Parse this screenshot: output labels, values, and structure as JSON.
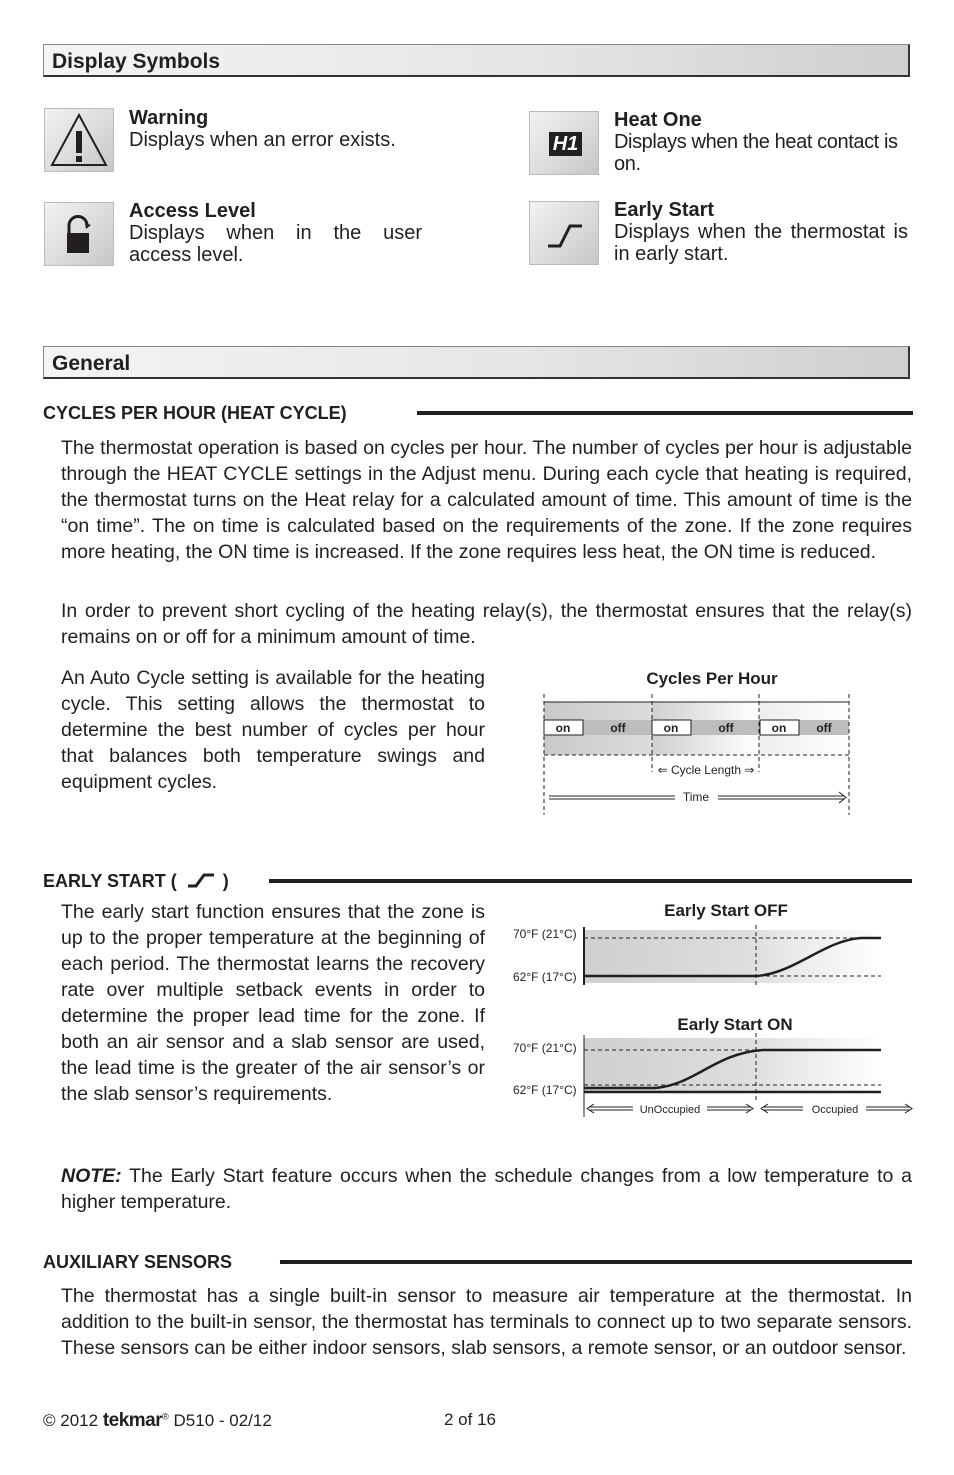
{
  "sections": {
    "display_symbols": {
      "title": "Display Symbols"
    },
    "general": {
      "title": "General"
    }
  },
  "symbols": [
    {
      "icon": "warning-icon",
      "title": "Warning",
      "desc": "Displays when an error exists."
    },
    {
      "icon": "heat-one-icon",
      "icon_text": "H1",
      "title": "Heat One",
      "desc": "Displays when the heat contact is on."
    },
    {
      "icon": "lock-icon",
      "title": "Access Level",
      "desc": "Displays when in the user access level."
    },
    {
      "icon": "early-start-icon",
      "title": "Early Start",
      "desc": "Displays when the thermostat is in early start."
    }
  ],
  "cycles": {
    "heading": "CYCLES PER HOUR (HEAT CYCLE)",
    "p1": "The thermostat operation is based on cycles per hour. The number of cycles per hour is adjustable through the HEAT CYCLE settings in the Adjust menu. During each cycle that heating is required, the thermostat turns on the Heat relay for a calculated amount of time. This amount of time is the “on time”. The on time is calculated based on the requirements of the zone. If the zone requires more heating, the ON time is increased. If the zone requires less heat, the ON time is reduced.",
    "p2": "In order to prevent short cycling of the heating relay(s), the thermostat ensures that the relay(s) remains on or off for a minimum amount of time.",
    "p3": "An Auto Cycle setting is available for the heating cycle. This setting allows the thermostat to determine the best number of cycles per hour that balances both temperature swings and equipment cycles.",
    "diagram": {
      "title": "Cycles Per Hour",
      "cycles": [
        {
          "on": "on",
          "off": "off"
        },
        {
          "on": "on",
          "off": "off"
        },
        {
          "on": "on",
          "off": "off"
        }
      ],
      "cycle_length_label": "⇐ Cycle Length ⇒",
      "time_label": "Time"
    }
  },
  "early_start": {
    "heading_prefix": "EARLY START (",
    "heading_suffix": ")",
    "p1": "The early start function ensures that the zone is up to the proper temperature at the beginning of each period. The thermostat learns the recovery rate over multiple setback events in order to determine the proper lead time for the zone. If both an air sensor and a slab sensor are used, the lead time is the greater of the air sensor’s or the slab sensor’s requirements.",
    "note_label": "NOTE:",
    "note_text": " The Early Start feature occurs when the schedule changes from a low temperature to a higher temperature.",
    "diagrams": {
      "off_title": "Early Start OFF",
      "on_title": "Early Start ON",
      "high_label": "70°F (21°C)",
      "low_label": "62°F (17°C)",
      "unoccupied_label": "UnOccupied",
      "occupied_label": "Occupied"
    }
  },
  "aux": {
    "heading": "AUXILIARY SENSORS",
    "p1": "The thermostat has a single built-in sensor to measure air temperature at the thermostat. In addition to the built-in sensor, the thermostat has terminals to connect up to two separate sensors. These sensors can be either indoor sensors, slab sensors, a remote sensor, or an outdoor sensor."
  },
  "footer": {
    "copyright": "© 2012",
    "brand": "tekmar",
    "reg": "®",
    "doc": "D510 - 02/12",
    "page": "2 of 16"
  }
}
